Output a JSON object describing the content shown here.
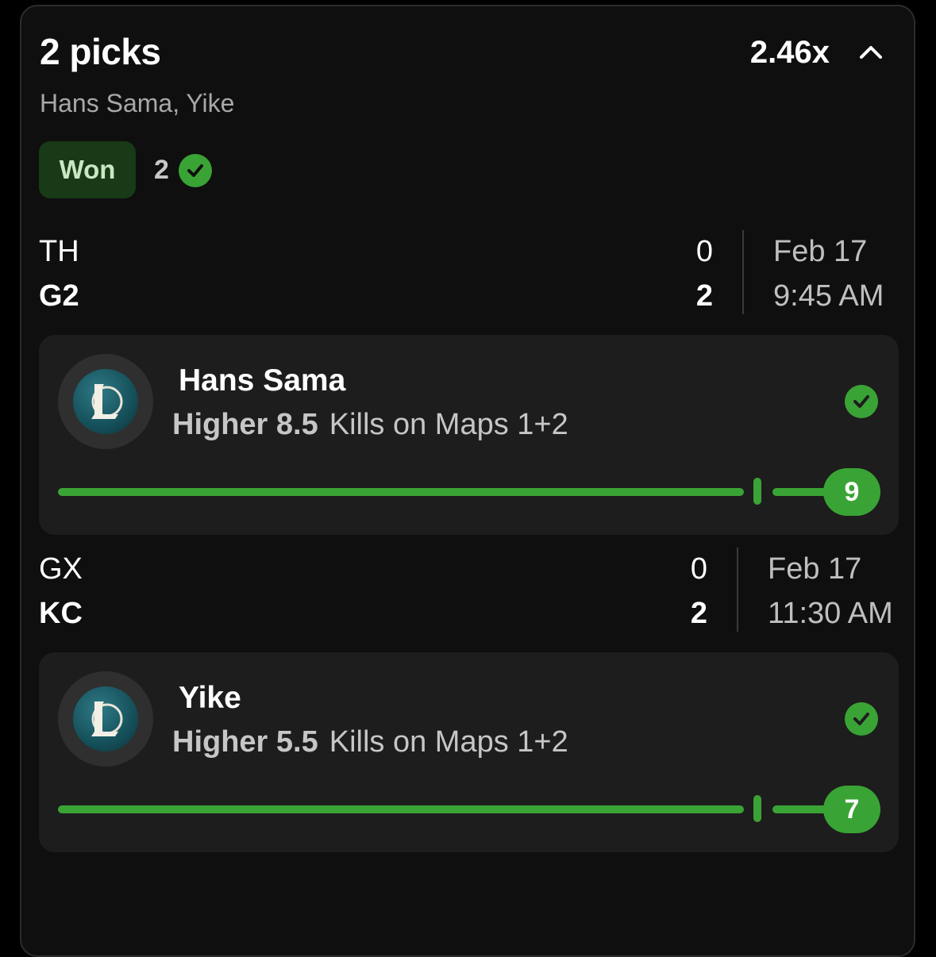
{
  "entry": {
    "title": "2 picks",
    "multiplier": "2.46x",
    "players_summary": "Hans Sama, Yike",
    "status_label": "Won",
    "correct_count": "2"
  },
  "matches": [
    {
      "team_top": "TH",
      "team_bottom": "G2",
      "score_top": "0",
      "score_bottom": "2",
      "date": "Feb 17",
      "time": "9:45 AM",
      "pick": {
        "player": "Hans Sama",
        "direction_line": "Higher 8.5",
        "market": "Kills on Maps 1+2",
        "line": 8.5,
        "result": "9"
      }
    },
    {
      "team_top": "GX",
      "team_bottom": "KC",
      "score_top": "0",
      "score_bottom": "2",
      "date": "Feb 17",
      "time": "11:30 AM",
      "pick": {
        "player": "Yike",
        "direction_line": "Higher 5.5",
        "market": "Kills on Maps 1+2",
        "line": 5.5,
        "result": "7"
      }
    }
  ],
  "colors": {
    "accent_green": "#3aa335",
    "won_badge_bg": "#183a16",
    "card_bg": "#0f0f0f",
    "pick_bg": "#1d1d1d"
  },
  "icons": {
    "collapse": "chevron-up-icon",
    "check": "check-circle-icon",
    "game_logo": "league-of-legends-logo"
  }
}
